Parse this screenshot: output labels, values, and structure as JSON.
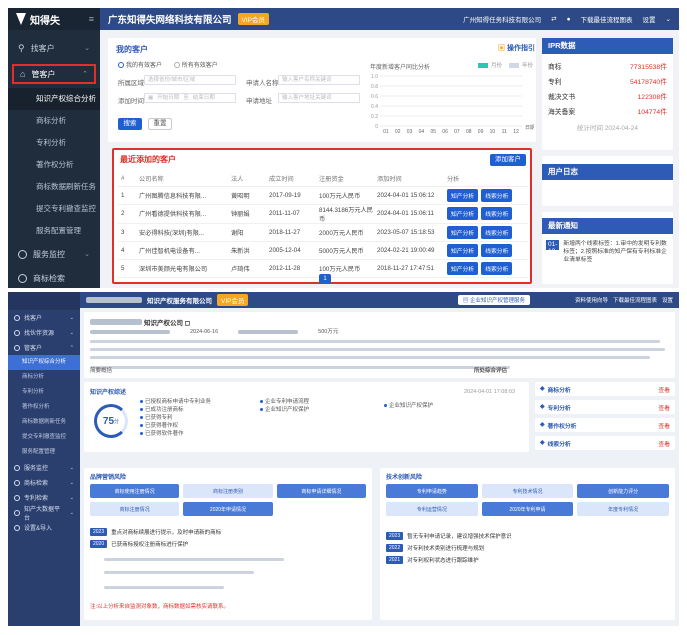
{
  "top": {
    "logo": "知得失",
    "company": "广东知得失网络科技有限公司",
    "company_badge": "VIP会员",
    "header_right": {
      "account": "广州知得任务科技有限公司",
      "download": "下载最佳流程图表",
      "settings": "设置"
    },
    "sidebar": [
      {
        "label": "找客户",
        "expanded": false
      },
      {
        "label": "管客户",
        "expanded": true
      }
    ],
    "sidebar_sub": [
      "知识产权综合分析",
      "商标分析",
      "专利分析",
      "著作权分析",
      "商标数据刷新任务",
      "提交专利撤查监控",
      "服务配置管理"
    ],
    "sidebar_bottom": [
      "服务监控",
      "商标检索"
    ],
    "my_clients": {
      "title": "我的客户",
      "guide": "操作指引",
      "radio_on": "我的有效客户",
      "radio_off": "所有有效客户",
      "region_label": "所属区域",
      "region_ph": "选择省份/城市/区域",
      "applicant_label": "申请人名称",
      "applicant_ph": "输入客户名称关键词",
      "time_label": "添加时间",
      "date_start": "开始日期",
      "date_sep": "至",
      "date_end": "结束日期",
      "address_label": "申请地址",
      "address_ph": "输入客户地址关键词",
      "search": "搜索",
      "reset": "重置",
      "chart_title": "年度新增客户同比分析",
      "chart_toggle_on": "月份",
      "chart_toggle_off": "年份",
      "chart_xlabel": "日期"
    },
    "chart_data": {
      "type": "bar",
      "categories": [
        "01",
        "02",
        "03",
        "04",
        "05",
        "06",
        "07",
        "08",
        "09",
        "10",
        "11",
        "12"
      ],
      "values": [
        0,
        0,
        0,
        0,
        0,
        0,
        0,
        0,
        0,
        0,
        0,
        0
      ],
      "yticks": [
        "0",
        "0.2",
        "0.4",
        "0.6",
        "0.8",
        "1.0"
      ],
      "ylim": [
        0,
        1
      ],
      "xlabel": "日期"
    },
    "recent": {
      "title": "最近添加的客户",
      "add": "添加客户",
      "columns": [
        "#",
        "公司名称",
        "法人",
        "成立时间",
        "注册资金",
        "添加时间",
        "分析"
      ],
      "rows": [
        {
          "n": "1",
          "name": "广州图腾信息科技有限...",
          "rep": "黄昭明",
          "est": "2017-09-19",
          "cap": "100万元人民币",
          "added": "2024-04-01 15:06:12"
        },
        {
          "n": "2",
          "name": "广州看德提供科技有限...",
          "rep": "钟丽娟",
          "est": "2011-11-07",
          "cap": "8144.3186万元人民币",
          "added": "2024-04-01 15:06:11"
        },
        {
          "n": "3",
          "name": "安必得科技(深圳)有限...",
          "rep": "谢阳",
          "est": "2018-11-27",
          "cap": "2000万元人民币",
          "added": "2023-05-07 15:18:53"
        },
        {
          "n": "4",
          "name": "广州佳智机电设备有...",
          "rep": "朱新洪",
          "est": "2005-12-04",
          "cap": "5000万元人民币",
          "added": "2024-02-21 19:00:49"
        },
        {
          "n": "5",
          "name": "深圳市美颜光电有限公司",
          "rep": "卢琦伟",
          "est": "2012-11-28",
          "cap": "100万元人民币",
          "added": "2018-11-27 17:47:51"
        }
      ],
      "btn_ip": "知产分析",
      "btn_clue": "线索分析",
      "page": "1"
    },
    "ipr": {
      "title": "IPR数据",
      "items": [
        {
          "k": "商标",
          "v": "77315538件"
        },
        {
          "k": "专利",
          "v": "54178740件"
        },
        {
          "k": "裁决文书",
          "v": "122308件"
        },
        {
          "k": "海关备案",
          "v": "104774件"
        }
      ],
      "stat_time": "统计时间 2024-04-24"
    },
    "log": {
      "title": "用户日志"
    },
    "notice": {
      "title": "最新通知",
      "date": "01-18",
      "text": "新增两个线索标签：1.审中的发明专利数标签；2.按照标准的知产保有专利标准企业清单标签"
    }
  },
  "bottom": {
    "company_suffix": "知识产权服务有限公司",
    "badge": "VIP会员",
    "hdr_btn": "企业知识产权管理服务",
    "hdr_right": [
      "资料使用向导",
      "下载最佳流程图表",
      "设置"
    ],
    "sidebar": [
      "找客户",
      "找伙伴资源",
      "管客户"
    ],
    "sidebar_sub": [
      "知识产权综合分析",
      "商标分析",
      "专利分析",
      "著作权分析",
      "商标数据刷新任务",
      "提交专利撤查监控",
      "服务配置管理"
    ],
    "sidebar_bottom": [
      "服务监控",
      "商标检索",
      "专利检索",
      "知产大数据平台",
      "设置&导入"
    ],
    "company_title_suffix": "知识产权公司 ◻",
    "reg_date": "2024-06-16",
    "reg_capital": "500万元",
    "summary_label": "简要概括",
    "evaluate_label": "所处综合评估",
    "score": "75",
    "score_unit": "分",
    "eval_date": "2024-04-01 17:08:03",
    "ip_overview": "知识产权综述",
    "col_a": [
      "已授权商标申请中专利业务",
      "已成功注册商标",
      "已获得专利",
      "已获得著作权",
      "已获得软件著作"
    ],
    "col_b": [
      "企业专利申请流程",
      "企业知识产权保护"
    ],
    "col_c": [
      "企业知识产权保护"
    ],
    "right_items": [
      {
        "label": "商标分析",
        "action": "查看"
      },
      {
        "label": "专利分析",
        "action": "查看"
      },
      {
        "label": "著作权分析",
        "action": "查看"
      },
      {
        "label": "线索分析",
        "action": "查看"
      }
    ],
    "trademark": {
      "title": "品牌营销风险",
      "steps": [
        "商标使用注册情况",
        "商标注册类别",
        "商标申请详细情况",
        "商标注册情况",
        "2020年申请情况"
      ],
      "rows": [
        {
          "year": "2023",
          "text": "重点对商标续展进行提示，及时申请新的商标"
        },
        {
          "year": "2020",
          "text": "已获商标授权注册商标进行保护"
        }
      ],
      "footnote": "注:以上分析来自监测对象数，商标数据如需核实请联系。"
    },
    "tech": {
      "title": "技术创新风险",
      "steps": [
        "专利申请趋势",
        "专利技术情况",
        "创新能力评分",
        "专利运营情况",
        "2020年专利申请",
        "年度专利情况"
      ],
      "rows": [
        {
          "year": "2023",
          "text": "暂无专利申请记录，建议增强技术保护意识"
        },
        {
          "year": "2022",
          "text": "对专利技术类别进行梳理与规划"
        },
        {
          "year": "2021",
          "text": "对专利权利状态进行跟踪维护"
        }
      ]
    }
  }
}
